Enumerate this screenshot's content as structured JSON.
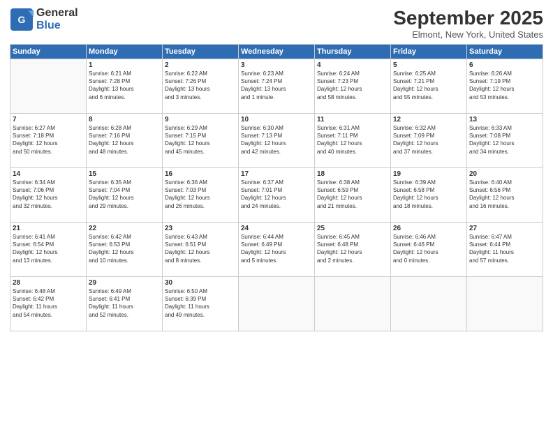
{
  "header": {
    "logo_line1": "General",
    "logo_line2": "Blue",
    "month": "September 2025",
    "location": "Elmont, New York, United States"
  },
  "days_of_week": [
    "Sunday",
    "Monday",
    "Tuesday",
    "Wednesday",
    "Thursday",
    "Friday",
    "Saturday"
  ],
  "weeks": [
    [
      {
        "day": "",
        "info": ""
      },
      {
        "day": "1",
        "info": "Sunrise: 6:21 AM\nSunset: 7:28 PM\nDaylight: 13 hours\nand 6 minutes."
      },
      {
        "day": "2",
        "info": "Sunrise: 6:22 AM\nSunset: 7:26 PM\nDaylight: 13 hours\nand 3 minutes."
      },
      {
        "day": "3",
        "info": "Sunrise: 6:23 AM\nSunset: 7:24 PM\nDaylight: 13 hours\nand 1 minute."
      },
      {
        "day": "4",
        "info": "Sunrise: 6:24 AM\nSunset: 7:23 PM\nDaylight: 12 hours\nand 58 minutes."
      },
      {
        "day": "5",
        "info": "Sunrise: 6:25 AM\nSunset: 7:21 PM\nDaylight: 12 hours\nand 55 minutes."
      },
      {
        "day": "6",
        "info": "Sunrise: 6:26 AM\nSunset: 7:19 PM\nDaylight: 12 hours\nand 53 minutes."
      }
    ],
    [
      {
        "day": "7",
        "info": "Sunrise: 6:27 AM\nSunset: 7:18 PM\nDaylight: 12 hours\nand 50 minutes."
      },
      {
        "day": "8",
        "info": "Sunrise: 6:28 AM\nSunset: 7:16 PM\nDaylight: 12 hours\nand 48 minutes."
      },
      {
        "day": "9",
        "info": "Sunrise: 6:29 AM\nSunset: 7:15 PM\nDaylight: 12 hours\nand 45 minutes."
      },
      {
        "day": "10",
        "info": "Sunrise: 6:30 AM\nSunset: 7:13 PM\nDaylight: 12 hours\nand 42 minutes."
      },
      {
        "day": "11",
        "info": "Sunrise: 6:31 AM\nSunset: 7:11 PM\nDaylight: 12 hours\nand 40 minutes."
      },
      {
        "day": "12",
        "info": "Sunrise: 6:32 AM\nSunset: 7:09 PM\nDaylight: 12 hours\nand 37 minutes."
      },
      {
        "day": "13",
        "info": "Sunrise: 6:33 AM\nSunset: 7:08 PM\nDaylight: 12 hours\nand 34 minutes."
      }
    ],
    [
      {
        "day": "14",
        "info": "Sunrise: 6:34 AM\nSunset: 7:06 PM\nDaylight: 12 hours\nand 32 minutes."
      },
      {
        "day": "15",
        "info": "Sunrise: 6:35 AM\nSunset: 7:04 PM\nDaylight: 12 hours\nand 29 minutes."
      },
      {
        "day": "16",
        "info": "Sunrise: 6:36 AM\nSunset: 7:03 PM\nDaylight: 12 hours\nand 26 minutes."
      },
      {
        "day": "17",
        "info": "Sunrise: 6:37 AM\nSunset: 7:01 PM\nDaylight: 12 hours\nand 24 minutes."
      },
      {
        "day": "18",
        "info": "Sunrise: 6:38 AM\nSunset: 6:59 PM\nDaylight: 12 hours\nand 21 minutes."
      },
      {
        "day": "19",
        "info": "Sunrise: 6:39 AM\nSunset: 6:58 PM\nDaylight: 12 hours\nand 18 minutes."
      },
      {
        "day": "20",
        "info": "Sunrise: 6:40 AM\nSunset: 6:56 PM\nDaylight: 12 hours\nand 16 minutes."
      }
    ],
    [
      {
        "day": "21",
        "info": "Sunrise: 6:41 AM\nSunset: 6:54 PM\nDaylight: 12 hours\nand 13 minutes."
      },
      {
        "day": "22",
        "info": "Sunrise: 6:42 AM\nSunset: 6:53 PM\nDaylight: 12 hours\nand 10 minutes."
      },
      {
        "day": "23",
        "info": "Sunrise: 6:43 AM\nSunset: 6:51 PM\nDaylight: 12 hours\nand 8 minutes."
      },
      {
        "day": "24",
        "info": "Sunrise: 6:44 AM\nSunset: 6:49 PM\nDaylight: 12 hours\nand 5 minutes."
      },
      {
        "day": "25",
        "info": "Sunrise: 6:45 AM\nSunset: 6:48 PM\nDaylight: 12 hours\nand 2 minutes."
      },
      {
        "day": "26",
        "info": "Sunrise: 6:46 AM\nSunset: 6:46 PM\nDaylight: 12 hours\nand 0 minutes."
      },
      {
        "day": "27",
        "info": "Sunrise: 6:47 AM\nSunset: 6:44 PM\nDaylight: 11 hours\nand 57 minutes."
      }
    ],
    [
      {
        "day": "28",
        "info": "Sunrise: 6:48 AM\nSunset: 6:42 PM\nDaylight: 11 hours\nand 54 minutes."
      },
      {
        "day": "29",
        "info": "Sunrise: 6:49 AM\nSunset: 6:41 PM\nDaylight: 11 hours\nand 52 minutes."
      },
      {
        "day": "30",
        "info": "Sunrise: 6:50 AM\nSunset: 6:39 PM\nDaylight: 11 hours\nand 49 minutes."
      },
      {
        "day": "",
        "info": ""
      },
      {
        "day": "",
        "info": ""
      },
      {
        "day": "",
        "info": ""
      },
      {
        "day": "",
        "info": ""
      }
    ]
  ]
}
